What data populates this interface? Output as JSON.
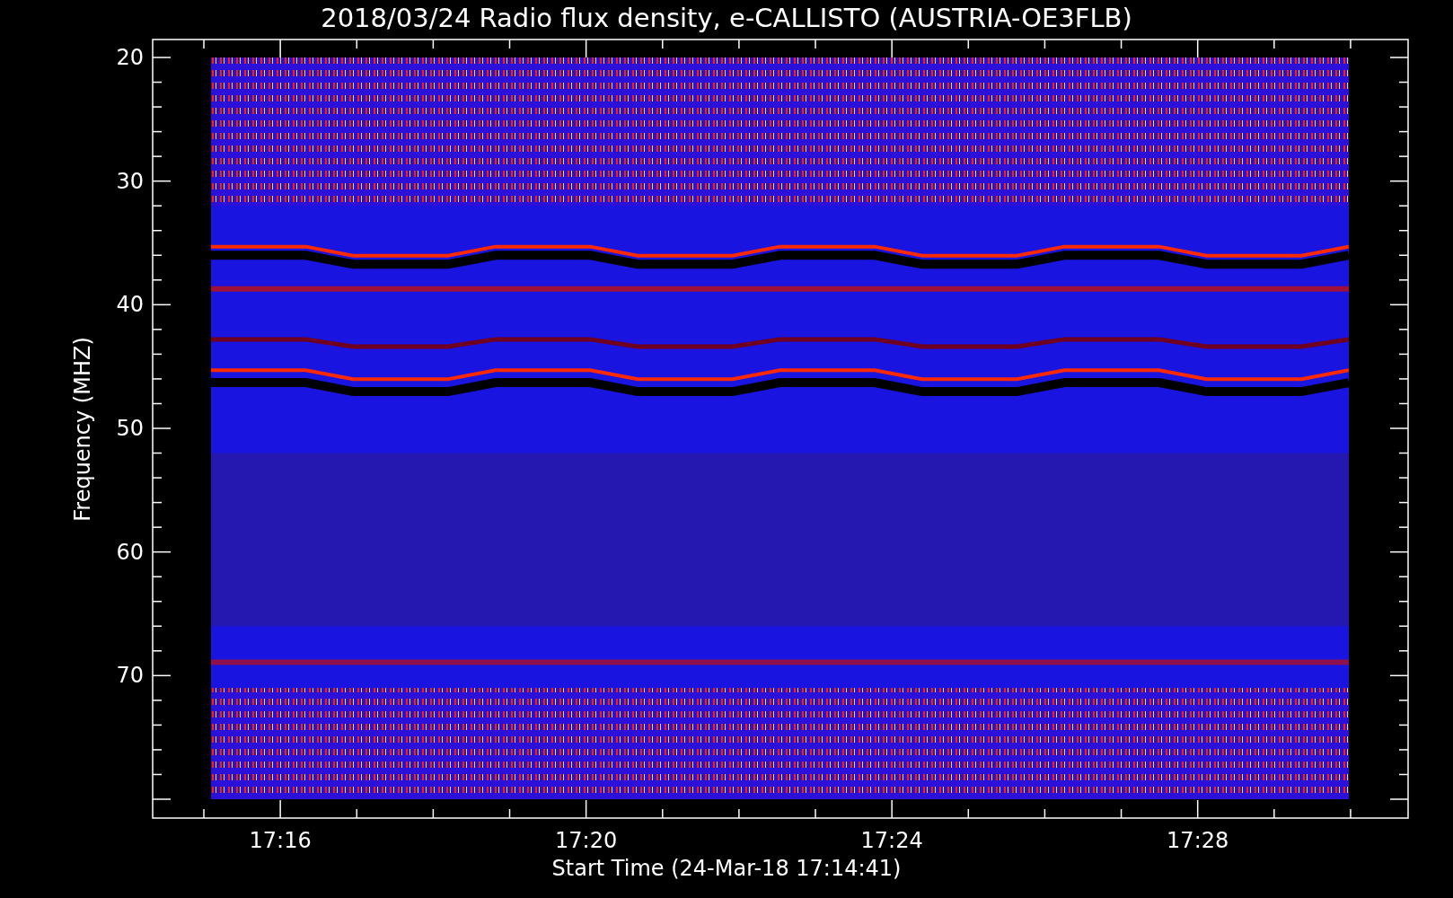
{
  "title": "2018/03/24  Radio flux density, e-CALLISTO (AUSTRIA-OE3FLB)",
  "y_axis": {
    "label": "Frequency (MHZ)",
    "ticks": [
      "20",
      "30",
      "40",
      "50",
      "60",
      "70"
    ]
  },
  "x_axis": {
    "label": "Start Time (24-Mar-18 17:14:41)",
    "ticks": [
      "17:16",
      "17:20",
      "17:24",
      "17:28"
    ]
  }
}
